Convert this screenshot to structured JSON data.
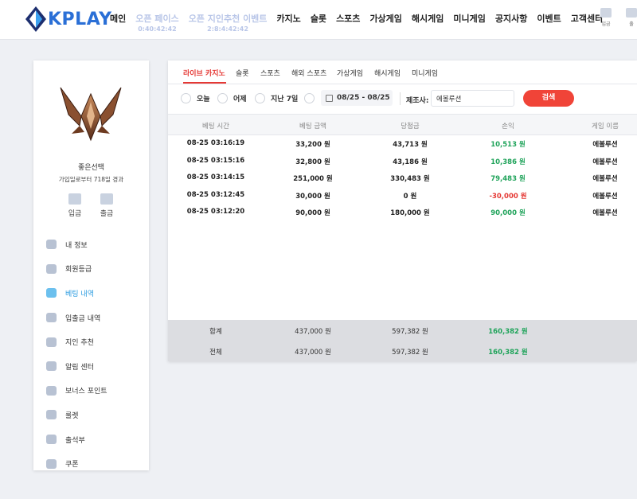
{
  "header": {
    "logo_text": "KPLAY",
    "nav": [
      {
        "label": "메인",
        "sub": ""
      },
      {
        "label": "오픈 페이스",
        "sub": "0:40:42:42",
        "promo": true
      },
      {
        "label": "오픈 지인추천 이벤트",
        "sub": "2:8:4:42:42",
        "promo": true
      },
      {
        "label": "카지노",
        "sub": ""
      },
      {
        "label": "슬롯",
        "sub": ""
      },
      {
        "label": "스포츠",
        "sub": ""
      },
      {
        "label": "가상게임",
        "sub": ""
      },
      {
        "label": "해시게임",
        "sub": ""
      },
      {
        "label": "미니게임",
        "sub": ""
      },
      {
        "label": "공지사항",
        "sub": ""
      },
      {
        "label": "이벤트",
        "sub": ""
      },
      {
        "label": "고객센터",
        "sub": ""
      }
    ],
    "icons": [
      {
        "label": "입금"
      },
      {
        "label": "출"
      }
    ]
  },
  "sidebar": {
    "username": "좋은선택",
    "joined": "가입일로부터 718일 경과",
    "quick": [
      {
        "label": "입금"
      },
      {
        "label": "출금"
      }
    ],
    "menu": [
      {
        "label": "내 정보",
        "icon": "user-icon"
      },
      {
        "label": "회원등급",
        "icon": "grade-icon"
      },
      {
        "label": "베팅 내역",
        "icon": "bet-history-icon",
        "active": true
      },
      {
        "label": "입출금 내역",
        "icon": "wallet-icon"
      },
      {
        "label": "지인 추천",
        "icon": "referral-icon"
      },
      {
        "label": "알림 센터",
        "icon": "bell-icon"
      },
      {
        "label": "보너스 포인트",
        "icon": "bonus-icon"
      },
      {
        "label": "룰렛",
        "icon": "roulette-icon"
      },
      {
        "label": "출석부",
        "icon": "attendance-icon"
      },
      {
        "label": "쿠폰",
        "icon": "coupon-icon"
      }
    ]
  },
  "tabs": [
    "라이브 카지노",
    "슬롯",
    "스포츠",
    "해외 스포츠",
    "가상게임",
    "해시게임",
    "미니게임"
  ],
  "filters": {
    "radios": [
      "오늘",
      "어제",
      "지난 7일"
    ],
    "date_range": "08/25 - 08/25",
    "maker_label": "제조사:",
    "maker_value": "에볼루션",
    "search_label": "검색"
  },
  "table": {
    "headers": [
      "베팅 시간",
      "베팅 금액",
      "당첨금",
      "손익",
      "게임 이름"
    ],
    "rows": [
      {
        "time": "08-25 03:16:19",
        "bet": "33,200 원",
        "win": "43,713 원",
        "profit": "10,513 원",
        "sign": "pos",
        "game": "에볼루션"
      },
      {
        "time": "08-25 03:15:16",
        "bet": "32,800 원",
        "win": "43,186 원",
        "profit": "10,386 원",
        "sign": "pos",
        "game": "에볼루션"
      },
      {
        "time": "08-25 03:14:15",
        "bet": "251,000 원",
        "win": "330,483 원",
        "profit": "79,483 원",
        "sign": "pos",
        "game": "에볼루션"
      },
      {
        "time": "08-25 03:12:45",
        "bet": "30,000 원",
        "win": "0 원",
        "profit": "-30,000 원",
        "sign": "neg",
        "game": "에볼루션"
      },
      {
        "time": "08-25 03:12:20",
        "bet": "90,000 원",
        "win": "180,000 원",
        "profit": "90,000 원",
        "sign": "pos",
        "game": "에볼루션"
      }
    ],
    "summary": [
      {
        "label": "합계",
        "bet": "437,000 원",
        "win": "597,382 원",
        "profit": "160,382 원"
      },
      {
        "label": "전체",
        "bet": "437,000 원",
        "win": "597,382 원",
        "profit": "160,382 원"
      }
    ]
  },
  "colors": {
    "brand": "#2a6fd6",
    "active_tab": "#e53935",
    "search_button": "#f04438",
    "profit_positive": "#1fa35a",
    "profit_negative": "#e53935",
    "active_menu": "#2a9be0"
  }
}
